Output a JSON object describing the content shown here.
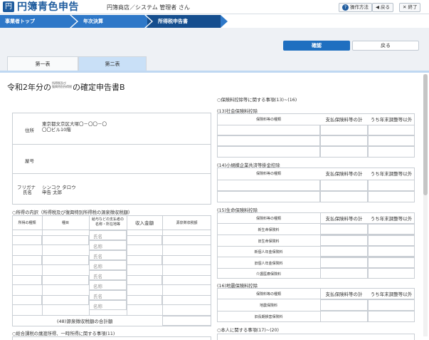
{
  "header": {
    "app_title": "円簿青色申告",
    "user_info": "円簿商店／システム 管理者 さん",
    "help_label": "操作方法",
    "back_label": "戻る",
    "close_label": "終了"
  },
  "breadcrumbs": [
    "事業者トップ",
    "年次決算",
    "所得税申告書"
  ],
  "actions": {
    "confirm_label": "確認",
    "back_label": "戻る"
  },
  "tabs": [
    "第一表",
    "第二表"
  ],
  "doc": {
    "title_prefix": "令和2年分の",
    "title_small1": "所得税及び",
    "title_small2": "復興特別所得税",
    "title_suffix": "の確定申告書B"
  },
  "taxpayer": {
    "address_label": "住所",
    "address_line1": "東京都文京区大塚〇－〇〇－〇",
    "address_line2": "〇〇ビル10階",
    "trade_name_label": "屋号",
    "furigana_label": "フリガナ",
    "name_label": "氏名",
    "furigana_value": "シンコク タロウ",
    "name_value": "申告 太郎"
  },
  "income_details": {
    "section_title": "○所得の内訳（所得税及び復興特別所得税の源泉徴収税額）",
    "col_type": "所得の種類",
    "col_item": "種目",
    "col_payer_line1": "給与などの支払者の",
    "col_payer_line2": "名称・所在地等",
    "col_income": "収入金額",
    "col_withholding": "源泉徴収税額",
    "name_placeholder": "氏名",
    "title_placeholder": "名称",
    "total_label": "(48)源泉徴収税額の合計額"
  },
  "bottom_left_section": "○総合課税の譲渡所得、一時所得に関する事項(11)",
  "insurance": {
    "section_title": "○保険料控除等に関する事項(13)~(16)",
    "social": {
      "title": "(13)社会保険料控除",
      "col_type": "保険料等の種類",
      "col_paid": "支払保険料等の計",
      "col_excl": "うち年末調整等以外"
    },
    "small_business": {
      "title": "(14)小規模企業共済等掛金控除",
      "col_type": "保険料等の種類",
      "col_paid": "支払保険料等の計",
      "col_excl": "うち年末調整等以外"
    },
    "life": {
      "title": "(15)生命保険料控除",
      "col_type": "保険料等の種類",
      "col_paid": "支払保険料等の計",
      "col_excl": "うち年末調整等以外",
      "rows": [
        "新生命保険料",
        "旧生命保険料",
        "新個人年金保険料",
        "旧個人年金保険料",
        "介護医療保険料"
      ]
    },
    "earthquake": {
      "title": "(16)地震保険料控除",
      "col_type": "保険料等の種類",
      "col_paid": "支払保険料等の計",
      "col_excl": "うち年末調整等以外",
      "rows": [
        "地震保険料",
        "旧長期損害保険料"
      ]
    }
  },
  "personal_section": "○本人に関する事項(17)~(20)"
}
